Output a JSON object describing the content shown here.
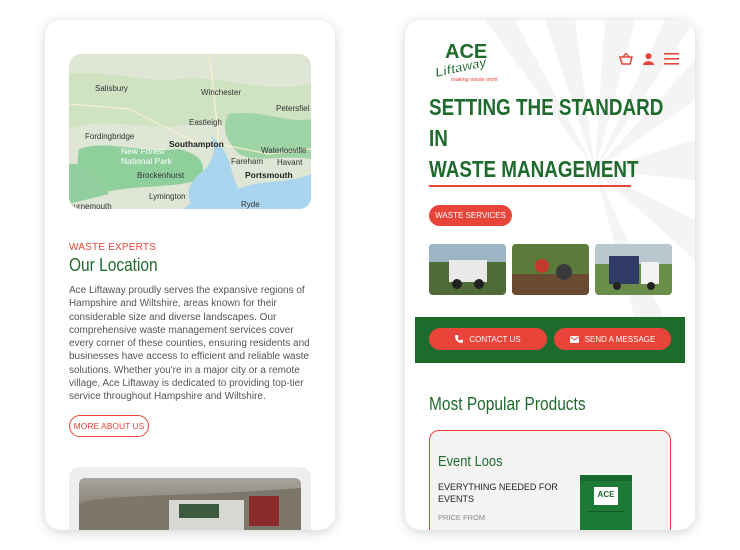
{
  "location_card": {
    "map": {
      "places": [
        "Salisbury",
        "Winchester",
        "Petersfiel",
        "Eastleigh",
        "Fordingbridge",
        "Southampton",
        "New Forest National Park",
        "Waterlooville",
        "Fareham",
        "Havant",
        "Brockenhurst",
        "Portsmouth",
        "Lymington",
        "Ryde",
        "ournemouth"
      ]
    },
    "eyebrow": "WASTE EXPERTS",
    "heading": "Our Location",
    "paragraph": "Ace Liftaway proudly serves the expansive regions of Hampshire and Wiltshire, areas known for their considerable size and diverse landscapes. Our comprehensive waste management services cover every corner of these counties, ensuring residents and businesses have access to efficient and reliable waste solutions. Whether you're in a major city or a remote village, Ace Liftaway is dedicated to providing top-tier service throughout Hampshire and Wiltshire.",
    "button": "MORE ABOUT US"
  },
  "home_card": {
    "logo": {
      "line1": "ACE",
      "line2": "Liftaway",
      "tagline": "making waste work"
    },
    "icons": [
      "basket-icon",
      "user-icon",
      "menu-icon"
    ],
    "hero_lines": [
      "SETTING THE STANDARD",
      "IN",
      "WASTE MANAGEMENT"
    ],
    "services_button": "WASTE SERVICES",
    "contact_button": "CONTACT US",
    "message_button": "SEND A MESSAGE",
    "products_heading": "Most Popular Products",
    "product": {
      "title": "Event Loos",
      "subtitle": "EVERYTHING NEEDED FOR EVENTS",
      "price_label": "PRICE FROM",
      "loo_label": "ACE"
    }
  },
  "colors": {
    "brand_green": "#1f6b2e",
    "accent_red": "#e8443a",
    "band_green": "#1d6b2d"
  }
}
